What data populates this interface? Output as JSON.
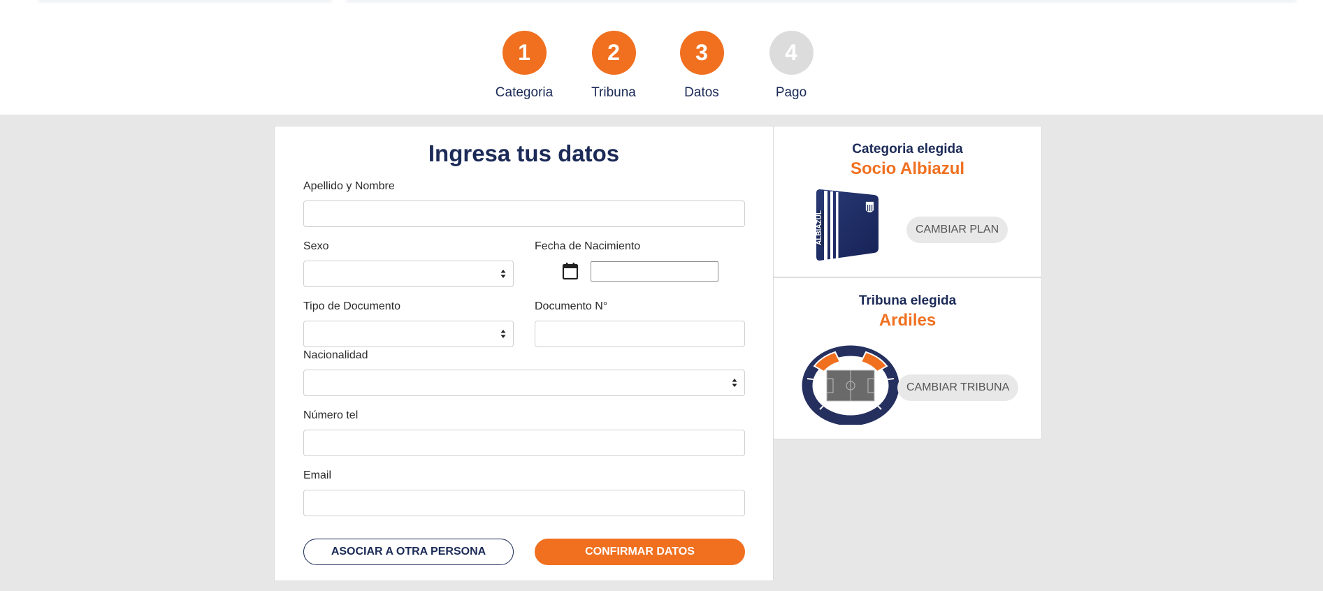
{
  "steps": [
    {
      "number": "1",
      "label": "Categoria",
      "state": "done"
    },
    {
      "number": "2",
      "label": "Tribuna",
      "state": "done"
    },
    {
      "number": "3",
      "label": "Datos",
      "state": "active"
    },
    {
      "number": "4",
      "label": "Pago",
      "state": "inactive"
    }
  ],
  "form": {
    "title": "Ingresa tus datos",
    "fields": {
      "nombre_label": "Apellido y Nombre",
      "sexo_label": "Sexo",
      "fecha_label": "Fecha de Nacimiento",
      "tipo_doc_label": "Tipo de Documento",
      "doc_num_label": "Documento N°",
      "nacionalidad_label": "Nacionalidad",
      "telefono_label": "Número tel",
      "email_label": "Email"
    },
    "buttons": {
      "asociar": "ASOCIAR A OTRA PERSONA",
      "confirmar": "CONFIRMAR DATOS"
    }
  },
  "sidebar": {
    "categoria": {
      "title": "Categoria elegida",
      "value": "Socio Albiazul",
      "card_text": "ALBIAZUL",
      "button": "CAMBIAR PLAN"
    },
    "tribuna": {
      "title": "Tribuna elegida",
      "value": "Ardiles",
      "button": "CAMBIAR TRIBUNA"
    }
  },
  "colors": {
    "accent": "#f07020",
    "navy": "#1b2a57",
    "inactive_step": "#dcdcdc",
    "background": "#e7e7e7"
  },
  "icons": [
    "calendar-icon",
    "select-arrows-icon",
    "membership-card-image",
    "stadium-map-image"
  ]
}
